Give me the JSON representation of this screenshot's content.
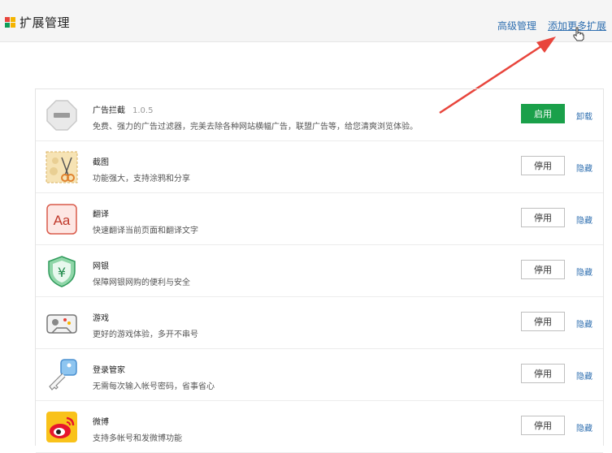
{
  "app": {
    "title": "扩展管理"
  },
  "header": {
    "advanced_label": "高级管理",
    "add_more_label": "添加更多扩展"
  },
  "extensions": [
    {
      "name": "广告拦截",
      "version": "1.0.5",
      "desc": "免费、强力的广告过滤器，完美去除各种网站横幅广告，联盟广告等，给您清爽浏览体验。",
      "button": "启用",
      "action": "卸载",
      "icon": "adblock-stop-icon"
    },
    {
      "name": "截图",
      "version": "",
      "desc": "功能强大，支持涂鸦和分享",
      "button": "停用",
      "action": "隐藏",
      "icon": "screenshot-scissors-icon"
    },
    {
      "name": "翻译",
      "version": "",
      "desc": "快速翻译当前页面和翻译文字",
      "button": "停用",
      "action": "隐藏",
      "icon": "translate-aa-icon"
    },
    {
      "name": "网银",
      "version": "",
      "desc": "保障网银网购的便利与安全",
      "button": "停用",
      "action": "隐藏",
      "icon": "bank-shield-icon"
    },
    {
      "name": "游戏",
      "version": "",
      "desc": "更好的游戏体验，多开不串号",
      "button": "停用",
      "action": "隐藏",
      "icon": "gamepad-icon"
    },
    {
      "name": "登录管家",
      "version": "",
      "desc": "无需每次输入帐号密码，省事省心",
      "button": "停用",
      "action": "隐藏",
      "icon": "key-icon"
    },
    {
      "name": "微博",
      "version": "",
      "desc": "支持多帐号和发微博功能",
      "button": "停用",
      "action": "隐藏",
      "icon": "weibo-icon"
    }
  ],
  "colors": {
    "enable_green": "#1aa04a",
    "link_blue": "#2f6fb0",
    "arrow_red": "#e8453c"
  }
}
